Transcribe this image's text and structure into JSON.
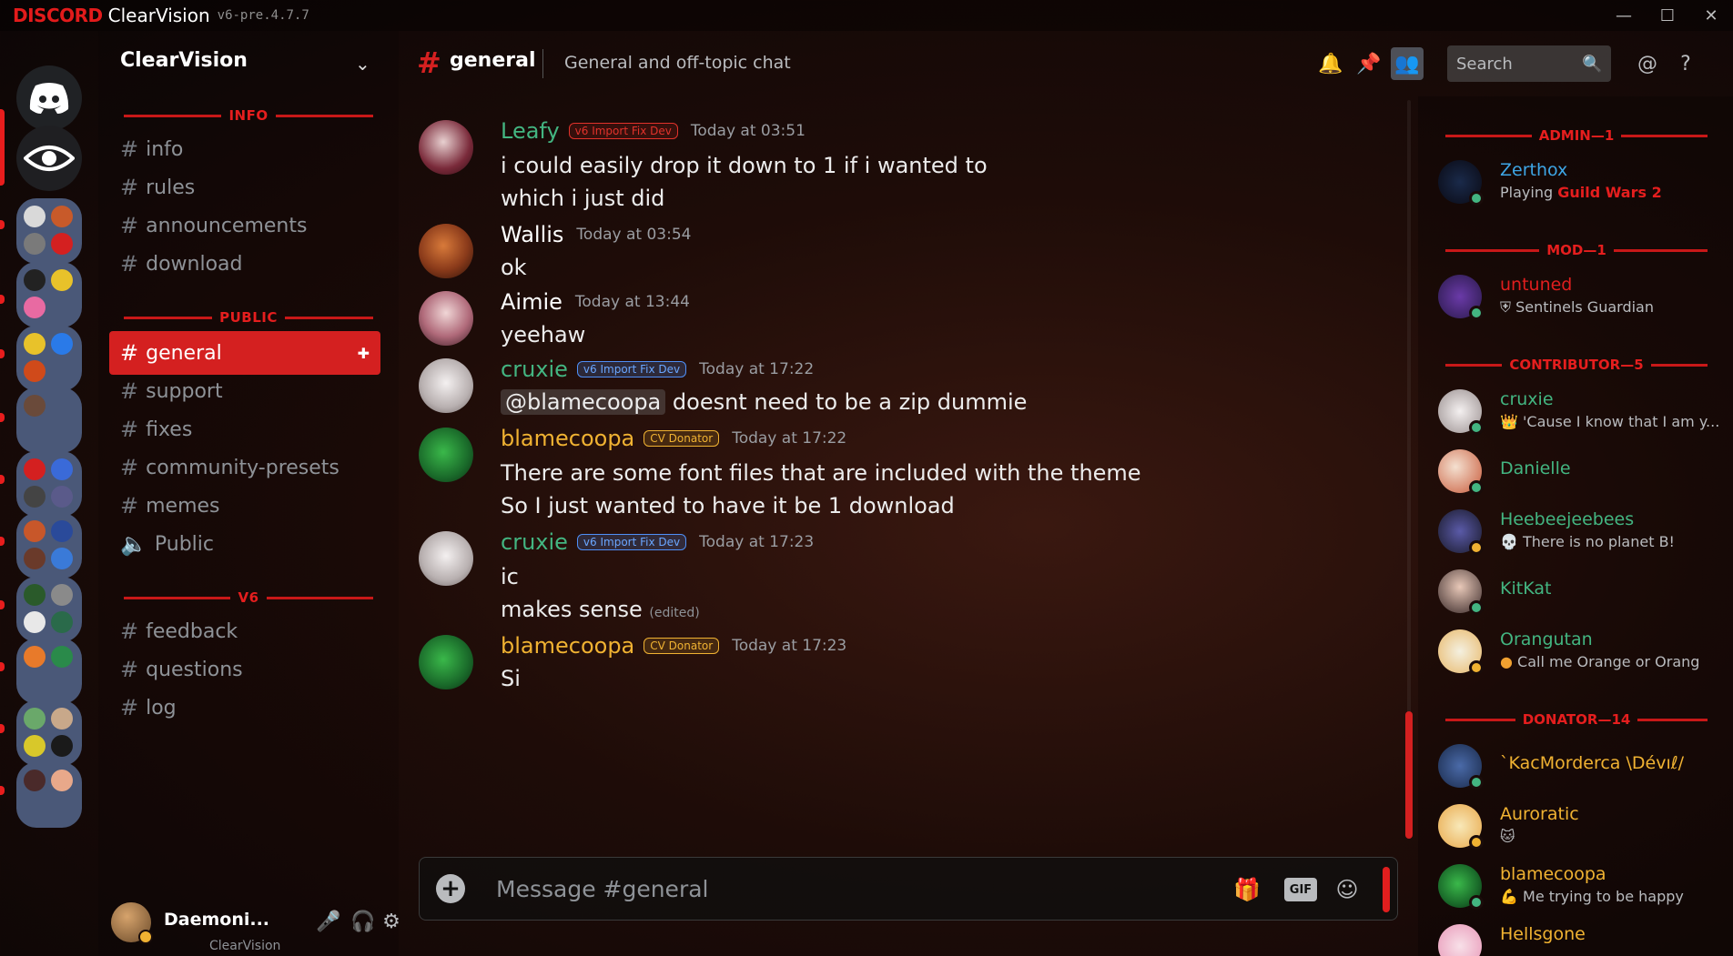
{
  "titlebar": {
    "brand": "DISCORD",
    "app": "ClearVision",
    "version": "v6-pre.4.7.7"
  },
  "server": {
    "name": "ClearVision",
    "footer": "ClearVision"
  },
  "categories": {
    "info": "INFO",
    "public": "PUBLIC",
    "v6": "V6"
  },
  "channels": {
    "info": [
      "info",
      "rules",
      "announcements",
      "download"
    ],
    "public": [
      "general",
      "support",
      "fixes",
      "community-presets",
      "memes"
    ],
    "voice": "Public",
    "v6": [
      "feedback",
      "questions",
      "log"
    ]
  },
  "user": {
    "name": "Daemoni..."
  },
  "header": {
    "channel": "general",
    "topic": "General and off-topic chat",
    "search_placeholder": "Search"
  },
  "messages": [
    {
      "author": "Leafy",
      "color": "#43b581",
      "badge": "v6 Import Fix Dev",
      "badge_color": "#e0322b",
      "time": "Today at 03:51",
      "lines": [
        "i could easily drop it down to 1 if i wanted to",
        "which i just did"
      ]
    },
    {
      "author": "Wallis",
      "color": "#ffffff",
      "time": "Today at 03:54",
      "lines": [
        "ok"
      ]
    },
    {
      "author": "Aimie",
      "color": "#ffffff",
      "time": "Today at 13:44",
      "lines": [
        "yeehaw"
      ]
    },
    {
      "author": "cruxie",
      "color": "#43b581",
      "badge": "v6 Import Fix Dev",
      "badge_color": "#4f8ff7",
      "time": "Today at 17:22",
      "mention": "@blamecoopa",
      "lines": [
        "doesnt need to be a zip dummie"
      ]
    },
    {
      "author": "blamecoopa",
      "color": "#f0b232",
      "badge": "CV Donator",
      "badge_color": "#f0b232",
      "time": "Today at 17:22",
      "lines": [
        "There are some font files that are included with the theme",
        "So I just wanted to have it be 1 download"
      ]
    },
    {
      "author": "cruxie",
      "color": "#43b581",
      "badge": "v6 Import Fix Dev",
      "badge_color": "#4f8ff7",
      "time": "Today at 17:23",
      "lines": [
        "ic",
        "makes sense"
      ],
      "edited": "(edited)"
    },
    {
      "author": "blamecoopa",
      "color": "#f0b232",
      "badge": "CV Donator",
      "badge_color": "#f0b232",
      "time": "Today at 17:23",
      "lines": [
        "Si"
      ]
    }
  ],
  "composer": {
    "placeholder": "Message #general",
    "gif": "GIF"
  },
  "member_groups": [
    {
      "label": "ADMIN—1"
    },
    {
      "label": "MOD—1"
    },
    {
      "label": "CONTRIBUTOR—5"
    },
    {
      "label": "DONATOR—14"
    }
  ],
  "members": [
    {
      "name": "Zerthox",
      "color": "#3ea6e6",
      "activity_prefix": "Playing ",
      "activity_game": "Guild Wars 2",
      "status": "online"
    },
    {
      "name": "untuned",
      "color": "#e01e1e",
      "activity": "Sentinels Guardian",
      "status": "online"
    },
    {
      "name": "cruxie",
      "color": "#43b581",
      "activity": "'Cause I know that I am y...",
      "status": "online"
    },
    {
      "name": "Danielle",
      "color": "#43b581",
      "activity": "",
      "status": "online"
    },
    {
      "name": "Heebeejeebees",
      "color": "#43b581",
      "activity": "There is no planet B!",
      "status": "idle"
    },
    {
      "name": "KitKat",
      "color": "#43b581",
      "activity": "",
      "status": "online"
    },
    {
      "name": "Orangutan",
      "color": "#43b581",
      "activity": "Call me Orange or Orang",
      "status": "idle"
    },
    {
      "name": "`KacMorderca \\Dévıℓ/",
      "color": "#f0b232",
      "activity": "",
      "status": "online"
    },
    {
      "name": "Auroratic",
      "color": "#f0b232",
      "activity": "",
      "status": "idle"
    },
    {
      "name": "blamecoopa",
      "color": "#f0b232",
      "activity": "Me trying to be happy",
      "status": "online"
    },
    {
      "name": "Hellsgone",
      "color": "#f0b232",
      "activity": "",
      "status": "online"
    }
  ],
  "colors": {
    "accent": "#d42020",
    "online": "#43b581",
    "idle": "#f0b232"
  }
}
